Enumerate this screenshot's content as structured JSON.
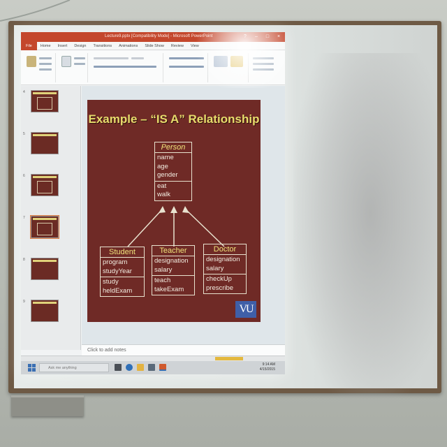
{
  "window": {
    "title": "Lecture9.pptx [Compatibility Mode] - Microsoft PowerPoint"
  },
  "menu_tabs": [
    "File",
    "Home",
    "Insert",
    "Design",
    "Transitions",
    "Animations",
    "Slide Show",
    "Review",
    "View"
  ],
  "slide": {
    "title": "Example – “IS A” Relationship",
    "logo": "VU",
    "parent_class": {
      "name": "Person",
      "attributes": [
        "name",
        "age",
        "gender"
      ],
      "operations": [
        "eat",
        "walk"
      ]
    },
    "child_classes": [
      {
        "name": "Student",
        "attributes": [
          "program",
          "studyYear"
        ],
        "operations": [
          "study",
          "heldExam"
        ]
      },
      {
        "name": "Teacher",
        "attributes": [
          "designation",
          "salary"
        ],
        "operations": [
          "teach",
          "takeExam"
        ]
      },
      {
        "name": "Doctor",
        "attributes": [
          "designation",
          "salary"
        ],
        "operations": [
          "checkUp",
          "prescribe"
        ]
      }
    ]
  },
  "thumbnails": [
    {
      "number": "4"
    },
    {
      "number": "5"
    },
    {
      "number": "6"
    },
    {
      "number": "7"
    },
    {
      "number": "8"
    },
    {
      "number": "9"
    }
  ],
  "notes_placeholder": "Click to add notes",
  "taskbar": {
    "search_placeholder": "Ask me anything",
    "time": "9:14 AM",
    "date": "4/15/2015"
  }
}
